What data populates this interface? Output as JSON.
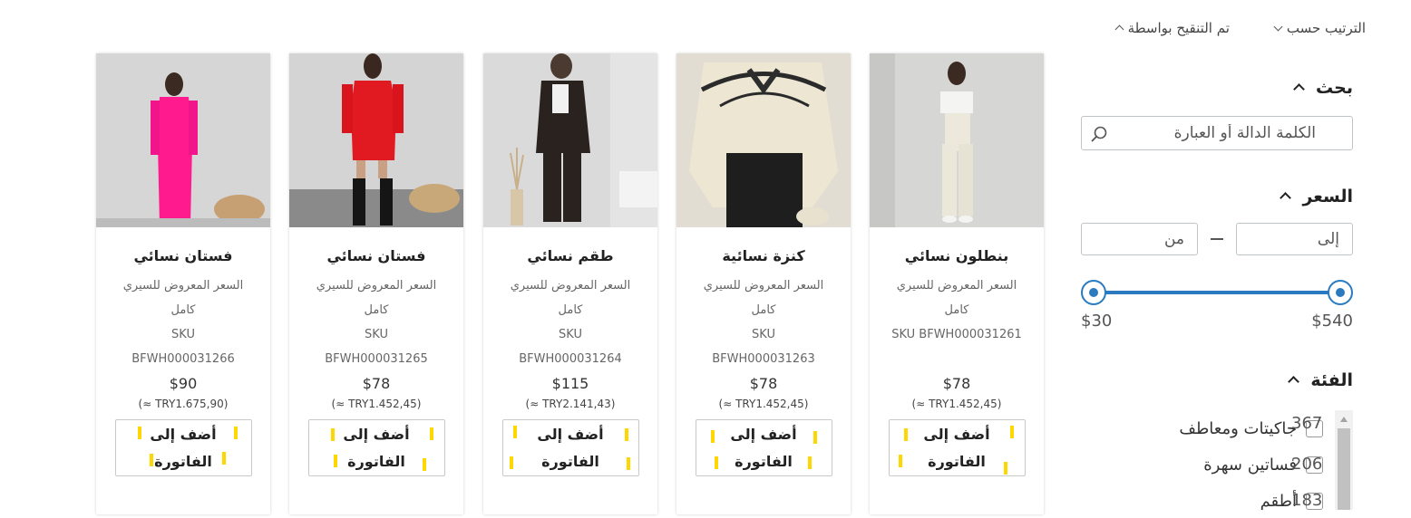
{
  "toolbar": {
    "sort_label": "الترتيب حسب",
    "filtered_label": "تم التنقيح بواسطة"
  },
  "sidebar": {
    "search": {
      "title": "بحث",
      "placeholder": "الكلمة الدالة أو العبارة"
    },
    "price": {
      "title": "السعر",
      "to_placeholder": "إلى",
      "from_placeholder": "من",
      "min_label": "$30",
      "max_label": "$540"
    },
    "category": {
      "title": "الفئة",
      "items": [
        {
          "label": "جاكيتات ومعاطف",
          "count": "367"
        },
        {
          "label": "فساتين سهرة",
          "count": "206"
        },
        {
          "label": "أطقم",
          "count": "183"
        }
      ]
    }
  },
  "products": [
    {
      "name": "بنطلون نسائي",
      "sub1": "السعر المعروض للسيري",
      "sub2": "كامل",
      "sku1": "SKU BFWH000031261",
      "sku2": "",
      "price": "$78",
      "try": "(≈ TRY1.452,45)",
      "add1": "أضف إلى",
      "add2": "الفاتورة",
      "img_bg": "#d8d8d6"
    },
    {
      "name": "كنزة نسائية",
      "sub1": "السعر المعروض للسيري",
      "sub2": "كامل",
      "sku1": "SKU",
      "sku2": "BFWH000031263",
      "price": "$78",
      "try": "(≈ TRY1.452,45)",
      "add1": "أضف إلى",
      "add2": "الفاتورة",
      "img_bg": "#e8e4dc"
    },
    {
      "name": "طقم نسائي",
      "sub1": "السعر المعروض للسيري",
      "sub2": "كامل",
      "sku1": "SKU",
      "sku2": "BFWH000031264",
      "price": "$115",
      "try": "(≈ TRY2.141,43)",
      "add1": "أضف إلى",
      "add2": "الفاتورة",
      "img_bg": "#dcdcdc"
    },
    {
      "name": "فستان نسائي",
      "sub1": "السعر المعروض للسيري",
      "sub2": "كامل",
      "sku1": "SKU",
      "sku2": "BFWH000031265",
      "price": "$78",
      "try": "(≈ TRY1.452,45)",
      "add1": "أضف إلى",
      "add2": "الفاتورة",
      "img_bg": "#d2d2d2"
    },
    {
      "name": "فستان نسائي",
      "sub1": "السعر المعروض للسيري",
      "sub2": "كامل",
      "sku1": "SKU",
      "sku2": "BFWH000031266",
      "price": "$90",
      "try": "(≈ TRY1.675,90)",
      "add1": "أضف إلى",
      "add2": "الفاتورة",
      "img_bg": "#dcdcdc"
    }
  ],
  "colors": {
    "accent": "#2a7ac0",
    "marker": "#ffd700"
  }
}
